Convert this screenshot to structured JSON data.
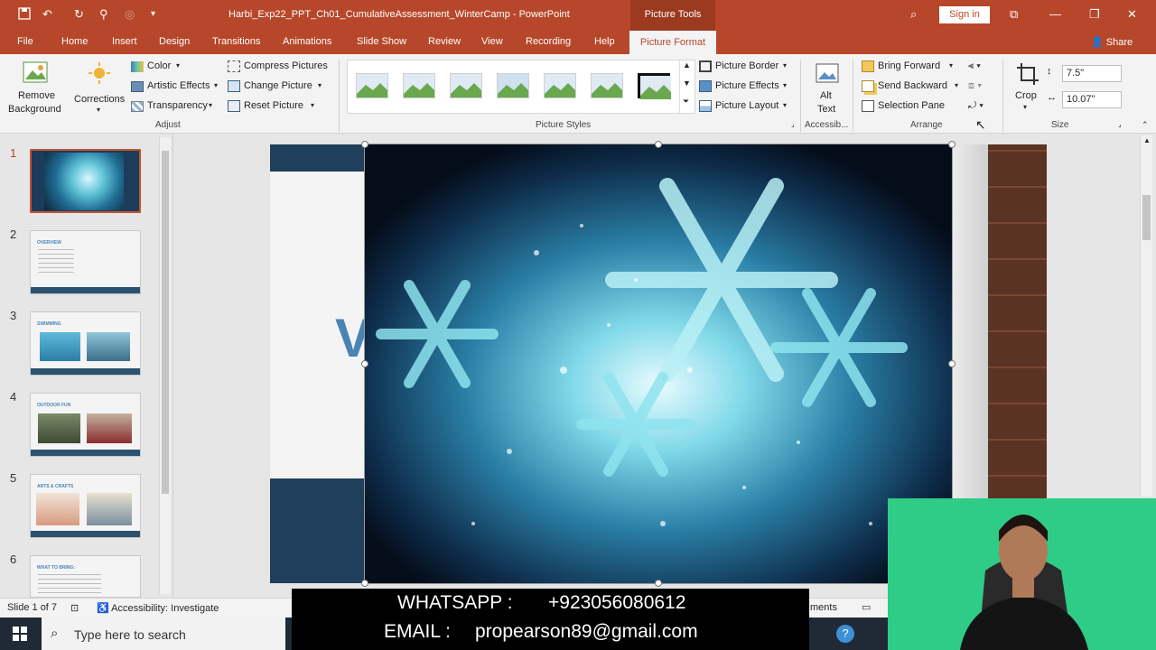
{
  "app": {
    "doc_title": "Harbi_Exp22_PPT_Ch01_CumulativeAssessment_WinterCamp - PowerPoint",
    "context_tab_group": "Picture Tools",
    "sign_in": "Sign in",
    "share": "Share"
  },
  "tabs": [
    "File",
    "Home",
    "Insert",
    "Design",
    "Transitions",
    "Animations",
    "Slide Show",
    "Review",
    "View",
    "Recording",
    "Help"
  ],
  "active_tab": "Picture Format",
  "ribbon": {
    "remove_background": [
      "Remove",
      "Background"
    ],
    "corrections": "Corrections",
    "color": "Color",
    "artistic_effects": "Artistic Effects",
    "transparency": "Transparency",
    "compress_pictures": "Compress Pictures",
    "change_picture": "Change Picture",
    "reset_picture": "Reset Picture",
    "group_adjust": "Adjust",
    "group_picture_styles": "Picture Styles",
    "picture_border": "Picture Border",
    "picture_effects": "Picture Effects",
    "picture_layout": "Picture Layout",
    "alt_text": [
      "Alt",
      "Text"
    ],
    "group_accessibility": "Accessib...",
    "bring_forward": "Bring Forward",
    "send_backward": "Send Backward",
    "selection_pane": "Selection Pane",
    "group_arrange": "Arrange",
    "crop": "Crop",
    "height": "7.5\"",
    "width": "10.07\"",
    "group_size": "Size"
  },
  "slides": [
    {
      "num": "1",
      "title": ""
    },
    {
      "num": "2",
      "title": "OVERVIEW"
    },
    {
      "num": "3",
      "title": "SWIMMING"
    },
    {
      "num": "4",
      "title": "OUTDOOR FUN"
    },
    {
      "num": "5",
      "title": "ARTS & CRAFTS"
    },
    {
      "num": "6",
      "title": "WHAT TO BRING:"
    }
  ],
  "status": {
    "slide_counter": "Slide 1 of 7",
    "accessibility": "Accessibility: Investigate",
    "comments_partial": "ments"
  },
  "taskbar": {
    "search_placeholder": "Type here to search"
  },
  "overlay": {
    "whatsapp_label": "WHATSAPP :",
    "whatsapp_number": "+923056080612",
    "email_label": "EMAIL :",
    "email_value": "propearson89@gmail.com"
  },
  "colors": {
    "accent": "#b7472a",
    "ribbon_bg": "#f3f3f3",
    "webcam_bg": "#2fcc87"
  }
}
